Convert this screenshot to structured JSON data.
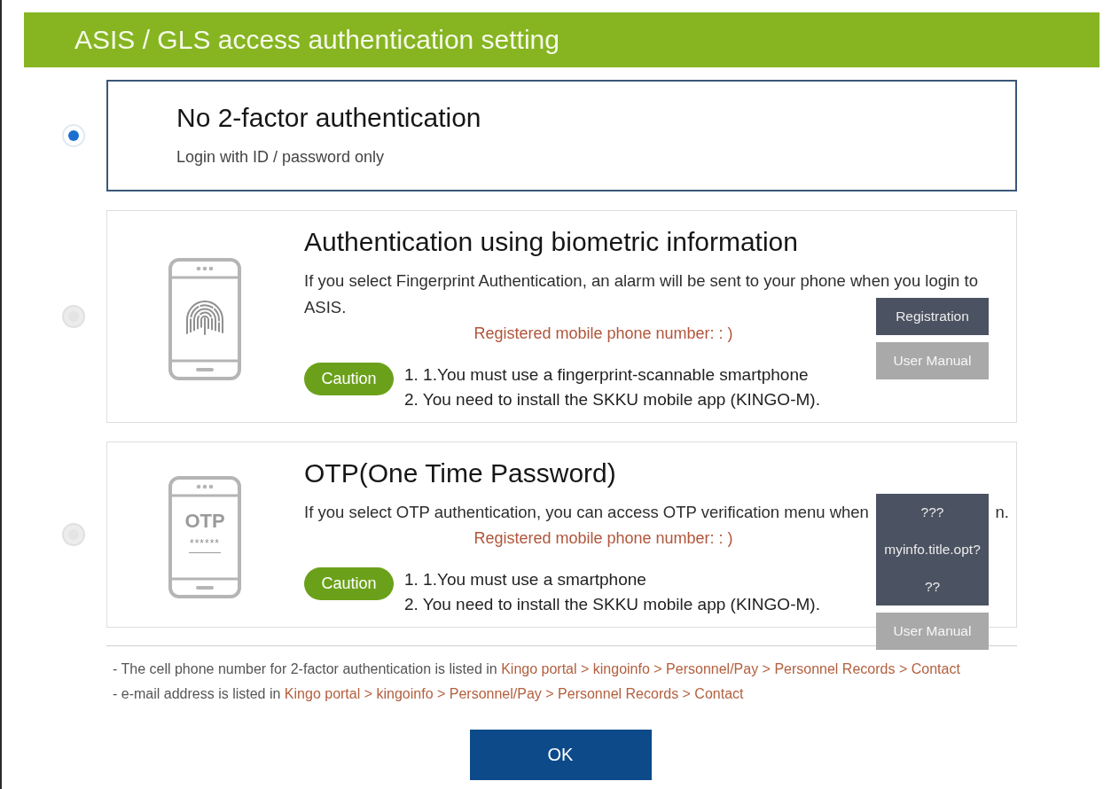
{
  "header": {
    "title": "ASIS / GLS access authentication setting"
  },
  "options": [
    {
      "kind": "plain",
      "selected": true,
      "title": "No 2-factor authentication",
      "description": [
        "Login with ID / password only"
      ]
    },
    {
      "kind": "biometric",
      "selected": false,
      "title": "Authentication using biometric information",
      "description": [
        "If you select Fingerprint Authentication, an alarm will be sent to your phone when you login to",
        "ASIS."
      ],
      "registered_phone": "Registered mobile phone number: : )",
      "caution": {
        "label": "Caution",
        "items": [
          "1. 1.You must use a fingerprint-scannable smartphone",
          "2. You need to install the SKKU mobile app (KINGO-M)."
        ]
      },
      "buttons": [
        {
          "kind": "primary",
          "lines": [
            "Registration"
          ]
        },
        {
          "kind": "secondary",
          "lines": [
            "User Manual"
          ]
        }
      ]
    },
    {
      "kind": "otp",
      "selected": false,
      "icon_text": {
        "label": "OTP",
        "mask": "******"
      },
      "title": "OTP(One Time Password)",
      "description": [
        "If you select OTP authentication, you can access OTP verification menu when",
        "n."
      ],
      "registered_phone": "Registered mobile phone number: : )",
      "caution": {
        "label": "Caution",
        "items": [
          "1. 1.You must use a smartphone",
          "2. You need to install the SKKU mobile app (KINGO-M)."
        ]
      },
      "buttons": [
        {
          "kind": "primary",
          "lines": [
            "???",
            "myinfo.title.opt?",
            "??"
          ]
        },
        {
          "kind": "secondary",
          "lines": [
            "User Manual"
          ]
        }
      ]
    }
  ],
  "notes": [
    {
      "text": "- The cell phone number for 2-factor authentication is listed in",
      "link": "Kingo portal > kingoinfo > Personnel/Pay > Personnel Records > Contact"
    },
    {
      "text": "- e-mail address is listed in",
      "link": "Kingo portal > kingoinfo > Personnel/Pay > Personnel Records > Contact"
    }
  ],
  "ok_button": {
    "label": "OK"
  }
}
